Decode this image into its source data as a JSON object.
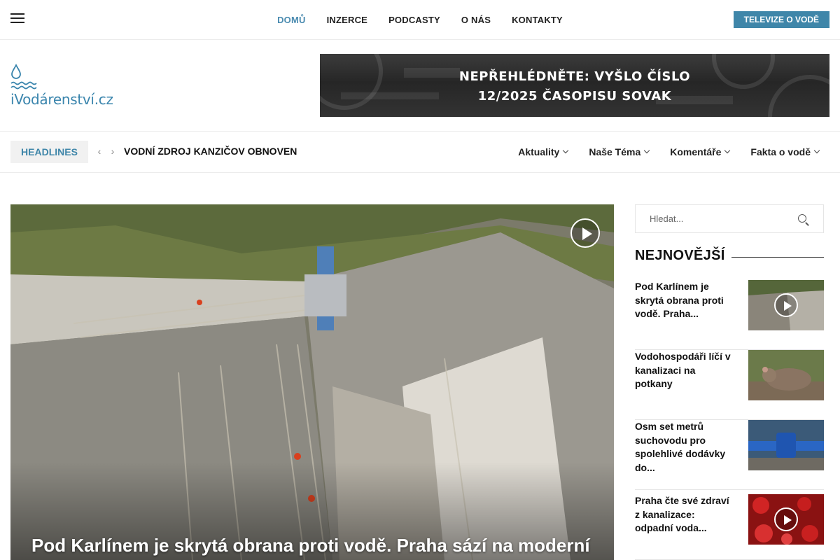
{
  "topbar": {
    "nav": [
      "DOMŮ",
      "INZERCE",
      "PODCASTY",
      "O NÁS",
      "KONTAKTY"
    ],
    "active_index": 0,
    "tv_button": "TELEVIZE O VODĚ"
  },
  "header": {
    "logo_text": "iVodárenství.cz",
    "banner_line1": "NEPŘEHLÉDNĚTE: VYŠLO ČÍSLO",
    "banner_line2": "12/2025 ČASOPISU SOVAK"
  },
  "catbar": {
    "headlines_label": "HEADLINES",
    "ticker": "VODNÍ ZDROJ KANZIČOV OBNOVEN",
    "categories": [
      "Aktuality",
      "Naše Téma",
      "Komentáře",
      "Fakta o vodě"
    ]
  },
  "hero": {
    "title": "Pod Karlínem je skrytá obrana proti vodě. Praha sází na moderní"
  },
  "sidebar": {
    "search_placeholder": "Hledat...",
    "heading": "NEJNOVĚJŠÍ",
    "posts": [
      {
        "title": "Pod Karlínem je skrytá obrana proti vodě. Praha...",
        "video": true
      },
      {
        "title": "Vodohospodáři líčí v kanalizaci na potkany",
        "video": false
      },
      {
        "title": "Osm set metrů suchovodu pro spolehlivé dodávky do...",
        "video": false
      },
      {
        "title": "Praha čte své zdraví z kanalizace: odpadní voda...",
        "video": true
      }
    ]
  },
  "colors": {
    "accent": "#3f86a9",
    "active_nav": "#4a8bb0"
  }
}
